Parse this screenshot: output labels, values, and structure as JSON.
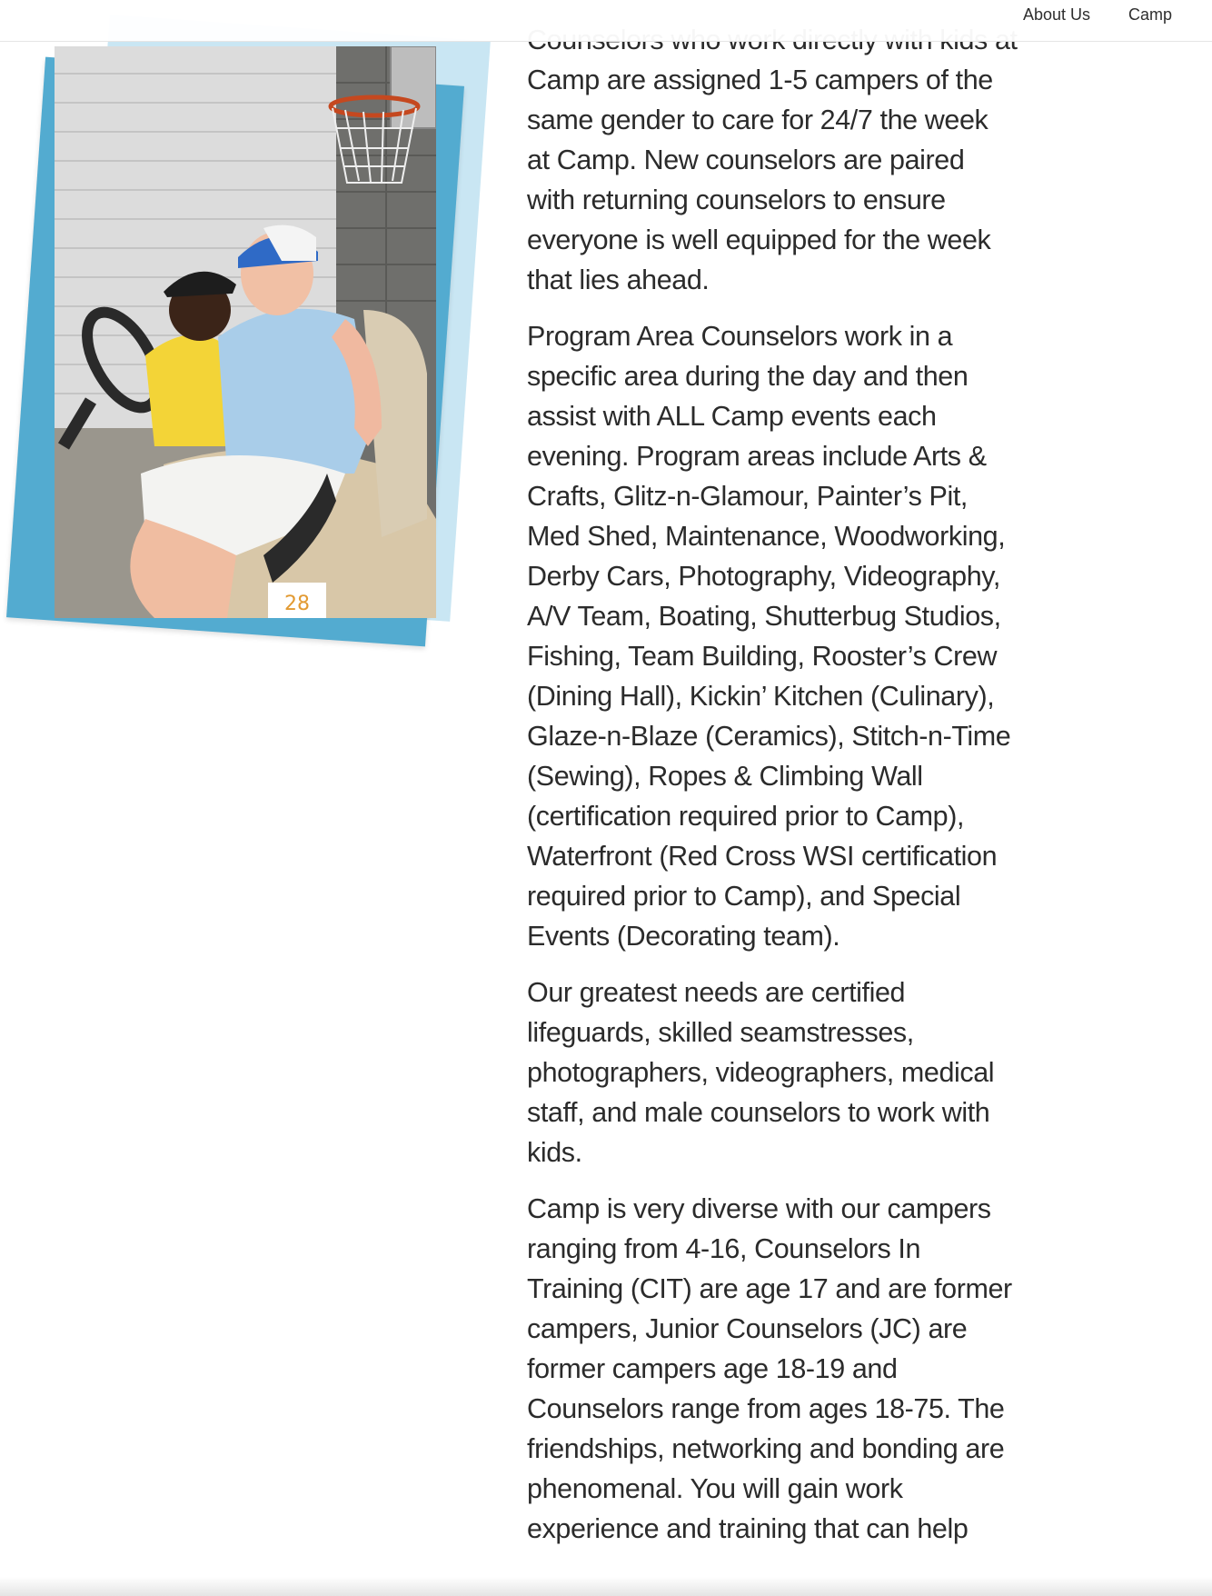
{
  "nav": {
    "about_label": "About Us",
    "camp_label": "Camp"
  },
  "photo": {
    "alt": "",
    "cart_number": "28"
  },
  "content": {
    "paragraphs": [
      "Counselors who work directly with kids at Camp are assigned 1-5 campers of the same gender to care for 24/7 the week at Camp. New counselors are paired with returning counselors to ensure everyone is well equipped for the week that lies ahead.",
      "Program Area Counselors work in a specific area during the day and then assist with ALL Camp events each evening. Program areas include Arts & Crafts, Glitz-n-Glamour, Painter’s Pit, Med Shed, Maintenance, Woodworking, Derby Cars, Photography, Videography, A/V Team, Boating, Shutterbug Studios, Fishing, Team Building, Rooster’s Crew (Dining Hall), Kickin’ Kitchen (Culinary), Glaze-n-Blaze (Ceramics), Stitch-n-Time (Sewing), Ropes & Climbing Wall (certification required prior to Camp), Waterfront (Red Cross WSI certification required prior to Camp), and Special Events (Decorating team).",
      "Our greatest needs are certified lifeguards, skilled seamstresses, photographers, videographers, medical staff, and male counselors to work with kids.",
      "Camp is very diverse with our campers ranging from 4-16, Counselors In Training (CIT) are age 17 and are former campers, Junior Counselors (JC) are former campers age 18-19 and Counselors range from ages 18-75. The friendships, networking and bonding are phenomenal. You will gain work experience and training that can help"
    ]
  },
  "colors": {
    "frame_blue": "#53abd0",
    "frame_light": "#c9e6f3",
    "text": "#2b2b2b"
  }
}
